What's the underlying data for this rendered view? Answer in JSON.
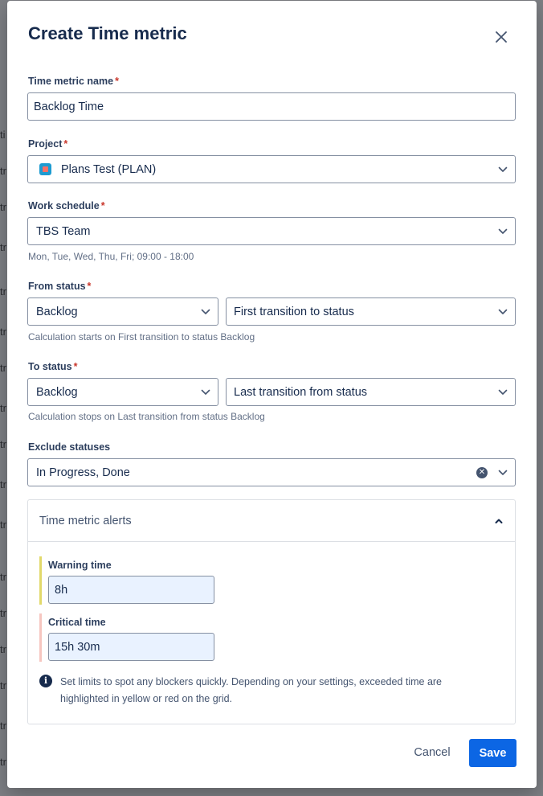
{
  "dialog": {
    "title": "Create Time metric"
  },
  "fields": {
    "name": {
      "label": "Time metric name",
      "required_mark": "*",
      "value": "Backlog Time"
    },
    "project": {
      "label": "Project",
      "required_mark": "*",
      "value": "Plans Test (PLAN)",
      "icon": "project-icon"
    },
    "work_schedule": {
      "label": "Work schedule",
      "required_mark": "*",
      "value": "TBS Team",
      "helper": "Mon, Tue, Wed, Thu, Fri; 09:00 - 18:00"
    },
    "from_status": {
      "label": "From status",
      "required_mark": "*",
      "status": "Backlog",
      "transition": "First transition to status",
      "helper": "Calculation starts on First transition to status Backlog"
    },
    "to_status": {
      "label": "To status",
      "required_mark": "*",
      "status": "Backlog",
      "transition": "Last transition from status",
      "helper": "Calculation stops on Last transition from status Backlog"
    },
    "exclude_statuses": {
      "label": "Exclude statuses",
      "value": "In Progress, Done"
    }
  },
  "alerts": {
    "title": "Time metric alerts",
    "expanded": true,
    "warning": {
      "label": "Warning time",
      "value": "8h",
      "color": "#e2d96a"
    },
    "critical": {
      "label": "Critical time",
      "value": "15h 30m",
      "color": "#f6c6c0"
    },
    "info": "Set limits to spot any blockers quickly. Depending on your settings, exceeded time are highlighted in yellow or red on the grid."
  },
  "actions": {
    "cancel": "Cancel",
    "save": "Save"
  },
  "colors": {
    "primary": "#0c66e4",
    "required": "#c9372c",
    "alert_input_bg": "#e9f2ff"
  }
}
